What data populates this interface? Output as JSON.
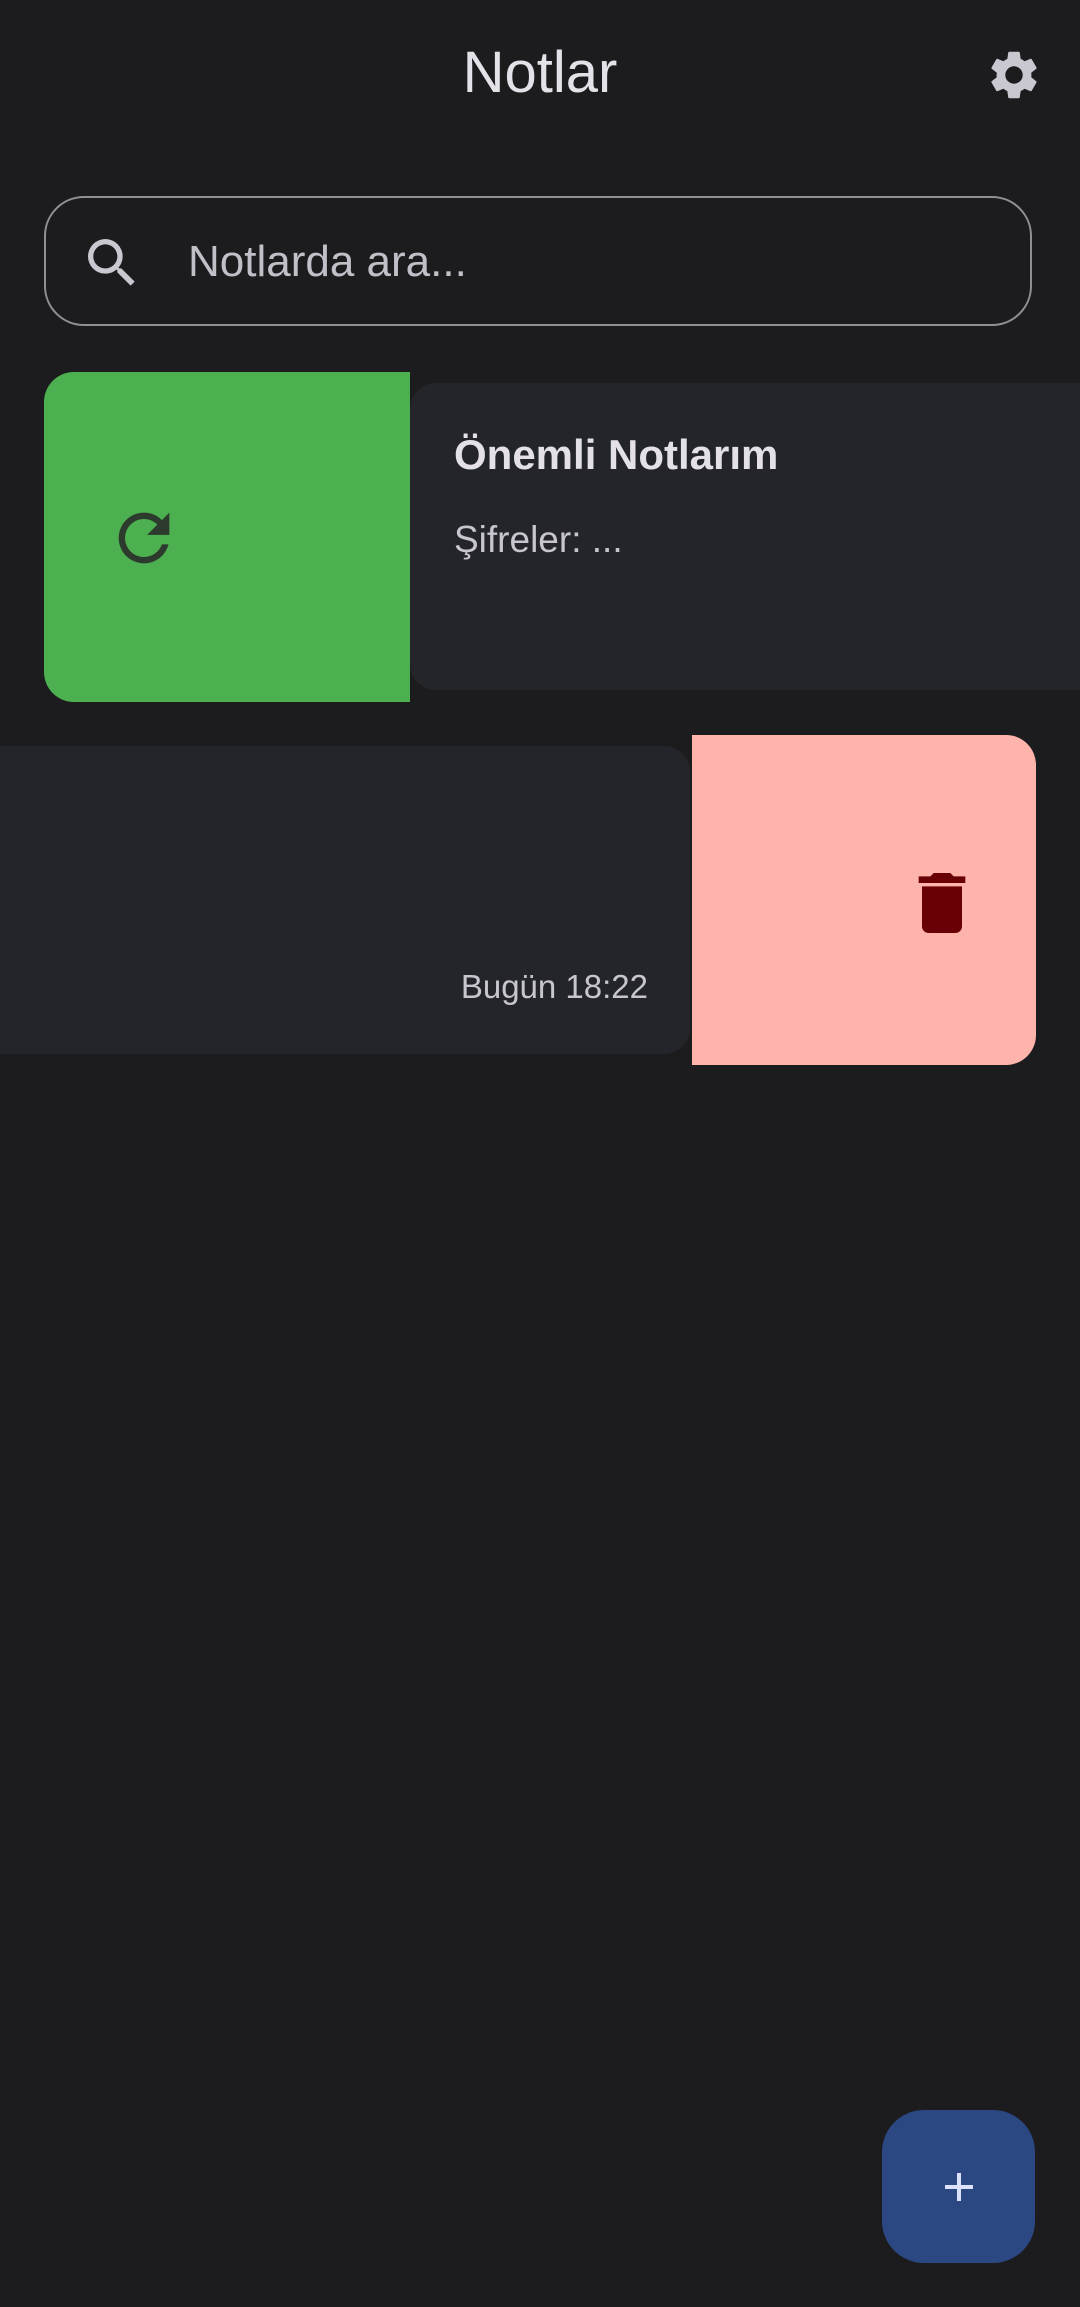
{
  "app_bar": {
    "title": "Notlar",
    "settings_icon": "gear-icon"
  },
  "search": {
    "placeholder": "Notlarda ara...",
    "value": "",
    "icon": "search-icon"
  },
  "notes": [
    {
      "title": "Önemli Notlarım",
      "preview": "Şifreler: ...",
      "swipe_action": {
        "icon": "restore-icon",
        "color": "#4caf50"
      }
    },
    {
      "title": "",
      "preview": "",
      "timestamp": "Bugün 18:22",
      "swipe_action": {
        "icon": "delete-icon",
        "color": "#ffb4ab"
      }
    }
  ],
  "fab": {
    "icon": "plus-icon",
    "color": "#2b4883"
  },
  "colors": {
    "background": "#1c1c1e",
    "card": "#24252b",
    "text_primary": "#e3e1e7",
    "text_secondary": "#c7c5cd"
  }
}
